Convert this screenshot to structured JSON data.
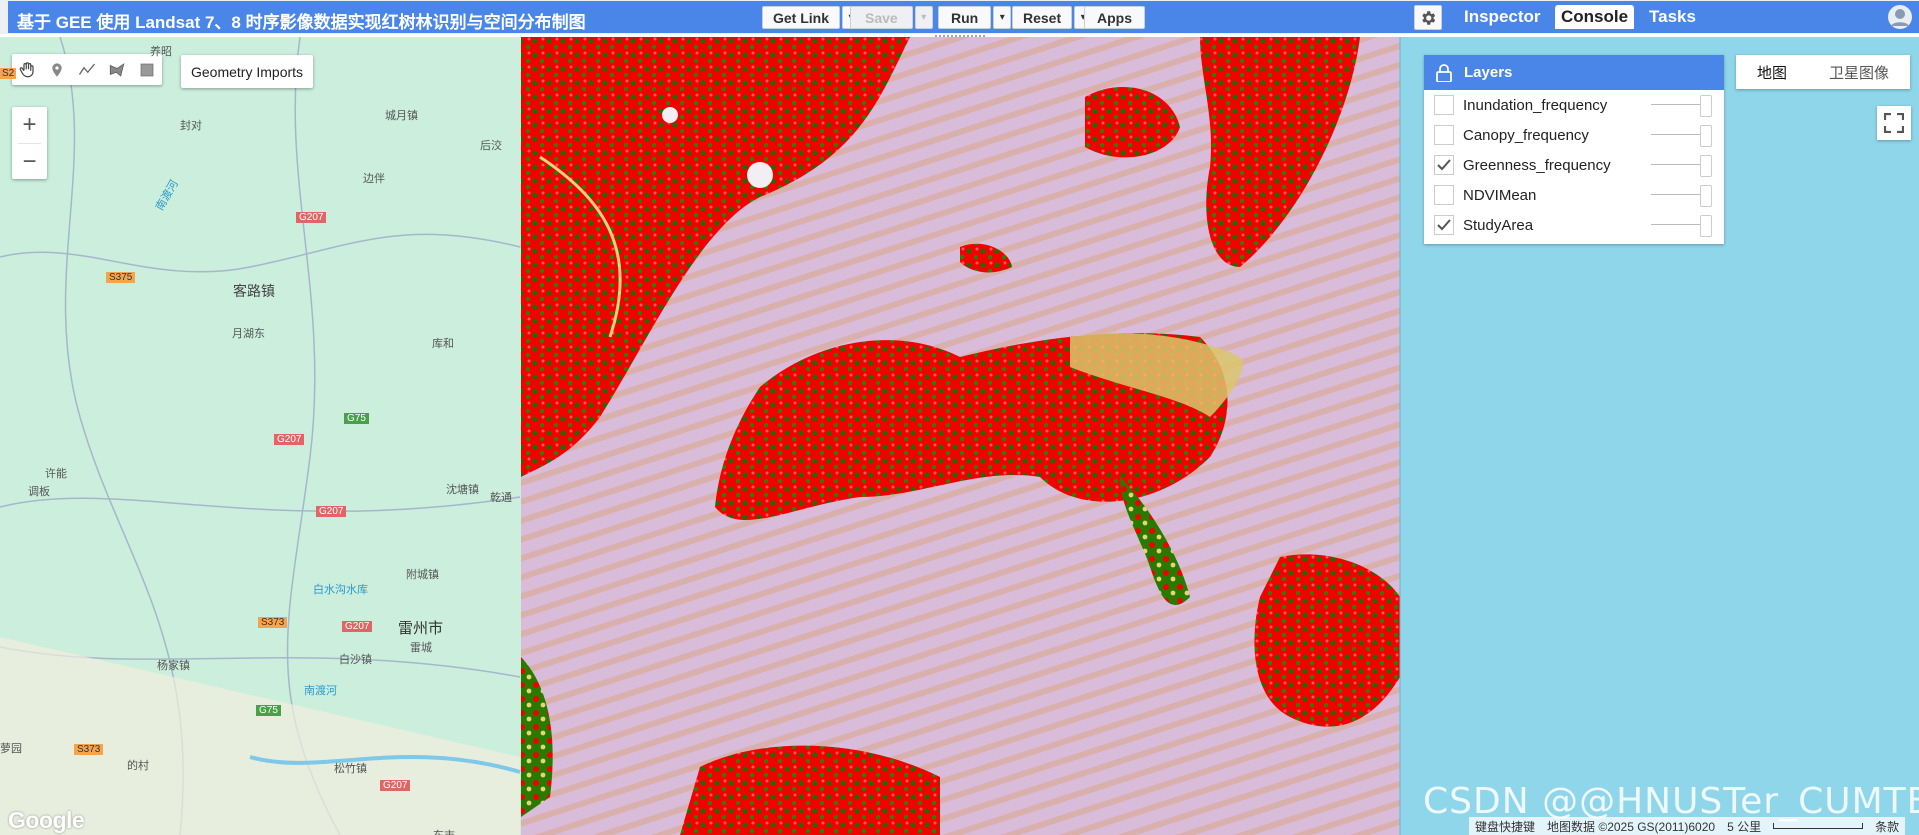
{
  "header": {
    "script_title": "基于 GEE 使用 Landsat 7、8 时序影像数据实现红树林识别与空间分布制图",
    "buttons": {
      "get_link": "Get Link",
      "save": "Save",
      "run": "Run",
      "reset": "Reset",
      "apps": "Apps"
    },
    "dropdown_glyph": "▾",
    "tabs": [
      "Inspector",
      "Console",
      "Tasks"
    ],
    "active_tab": "Console"
  },
  "map": {
    "geometry_tools": [
      "hand-icon",
      "marker-icon",
      "line-icon",
      "polygon-icon",
      "rectangle-icon"
    ],
    "geometry_imports_label": "Geometry Imports",
    "zoom_in": "+",
    "zoom_out": "−",
    "map_types": [
      "地图",
      "卫星图像"
    ],
    "active_map_type": "地图",
    "place_labels": [
      "封对",
      "城月镇",
      "后洨",
      "边伴",
      "南渡河",
      "G207",
      "S375",
      "客路镇",
      "月湖东",
      "库和",
      "G75",
      "G207",
      "许能",
      "调板",
      "G207",
      "沈塘镇",
      "乾通",
      "附城镇",
      "白水沟水库",
      "S373",
      "G207",
      "雷州市",
      "雷城",
      "白沙镇",
      "杨家镇",
      "南渡河",
      "G75",
      "S373",
      "萝园",
      "的村",
      "松竹镇",
      "G207",
      "东市",
      "养昭",
      "S2"
    ],
    "layers_panel": {
      "title": "Layers",
      "layers": [
        {
          "name": "Inundation_frequency",
          "checked": false
        },
        {
          "name": "Canopy_frequency",
          "checked": false
        },
        {
          "name": "Greenness_frequency",
          "checked": true
        },
        {
          "name": "NDVIMean",
          "checked": false
        },
        {
          "name": "StudyArea",
          "checked": true
        }
      ]
    },
    "attribution": {
      "shortcuts": "键盘快捷键",
      "data": "地图数据 ©2025 GS(2011)6020",
      "scale": "5 公里",
      "terms": "条款"
    },
    "watermark": "CSDN @@HNUSTer_CUMTBer",
    "google_logo": "Google"
  },
  "colors": {
    "header_blue": "#4a86e8",
    "mangrove_red": "#ff0000",
    "vegetation_green": "#1a6b00",
    "water_pink": "#d8bcd9",
    "sea_blue": "#8fd6ea",
    "basemap_green": "#cbeedd"
  }
}
